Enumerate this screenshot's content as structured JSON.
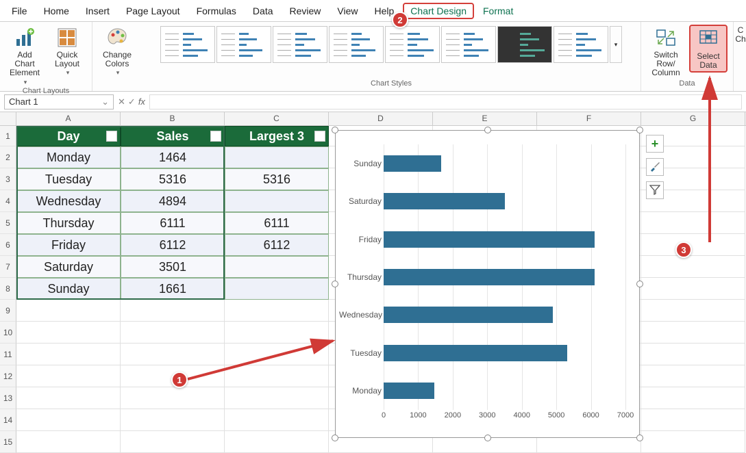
{
  "menubar": {
    "items": [
      "File",
      "Home",
      "Insert",
      "Page Layout",
      "Formulas",
      "Data",
      "Review",
      "View",
      "Help",
      "Chart Design",
      "Format"
    ],
    "active_index": 9
  },
  "ribbon": {
    "chart_layouts": {
      "label": "Chart Layouts",
      "add_chart_element": "Add Chart Element",
      "quick_layout": "Quick Layout"
    },
    "change_colors": "Change Colors",
    "chart_styles_label": "Chart Styles",
    "data_group": {
      "label": "Data",
      "switch": "Switch Row/ Column",
      "select": "Select Data"
    },
    "next_group_partial": "C\nCh"
  },
  "namebox": "Chart 1",
  "columns": [
    "A",
    "B",
    "C",
    "D",
    "E",
    "F",
    "G"
  ],
  "rows": [
    "1",
    "2",
    "3",
    "4",
    "5",
    "6",
    "7",
    "8",
    "9",
    "10",
    "11",
    "12",
    "13",
    "14",
    "15"
  ],
  "table": {
    "headers": [
      "Day",
      "Sales",
      "Largest 3"
    ],
    "data": [
      [
        "Monday",
        "1464",
        ""
      ],
      [
        "Tuesday",
        "5316",
        "5316"
      ],
      [
        "Wednesday",
        "4894",
        ""
      ],
      [
        "Thursday",
        "6111",
        "6111"
      ],
      [
        "Friday",
        "6112",
        "6112"
      ],
      [
        "Saturday",
        "3501",
        ""
      ],
      [
        "Sunday",
        "1661",
        ""
      ]
    ]
  },
  "chart_data": {
    "type": "bar",
    "orientation": "horizontal",
    "categories": [
      "Sunday",
      "Saturday",
      "Friday",
      "Thursday",
      "Wednesday",
      "Tuesday",
      "Monday"
    ],
    "values": [
      1661,
      3501,
      6112,
      6111,
      4894,
      5316,
      1464
    ],
    "xlim": [
      0,
      7000
    ],
    "x_ticks": [
      0,
      1000,
      2000,
      3000,
      4000,
      5000,
      6000,
      7000
    ],
    "title": "",
    "xlabel": "",
    "ylabel": ""
  },
  "annotations": {
    "badge1": "1",
    "badge2": "2",
    "badge3": "3"
  },
  "icons": {
    "add_chart_element": "bar-chart-plus",
    "quick_layout": "layout-grid",
    "change_colors": "palette",
    "switch_rowcol": "swap",
    "select_data": "table-select",
    "chart_plus": "plus",
    "chart_brush": "brush",
    "chart_filter": "funnel",
    "chevron_down": "▾",
    "namebox_dd": "⌄",
    "fx_cancel": "✕",
    "fx_ok": "✓",
    "fx": "fx",
    "filter_drop": "▾"
  }
}
